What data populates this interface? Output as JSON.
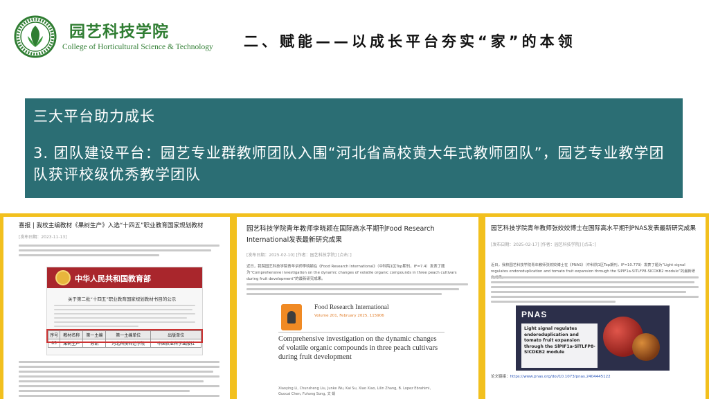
{
  "header": {
    "logo_cn": "园艺科技学院",
    "logo_en": "College of Horticultural Science & Technology",
    "title": "二、赋能——以成长平台夯实“家”的本领"
  },
  "banner": {
    "heading": "三大平台助力成长",
    "body": "3. 团队建设平台：园艺专业群教师团队入围“河北省高校黄大年式教师团队”，园艺专业教学团队获评校级优秀教学团队"
  },
  "colors": {
    "banner_bg": "#2b6e74",
    "frame": "#f2c01e",
    "logo_green": "#2f7d32"
  },
  "docs": {
    "doc1": {
      "title": "喜报 | 我校主编教材《果树生产》入选“十四五”职业教育国家规划教材",
      "meta": "[发布日期：2023-11-13]",
      "moe_name": "中华人民共和国教育部",
      "notice": "关于第二批“十四五”职业教育国家规划教材书目的公示",
      "table": {
        "headers": [
          "序号",
          "教材名称",
          "第一主编",
          "第一主编单位",
          "出版单位"
        ],
        "row": [
          "85",
          "果树生产",
          "苏凯",
          "河北科技师范学院",
          "中国农业科学出版社"
        ]
      }
    },
    "doc2": {
      "title": "园艺科技学院青年教师李晓颖在国际高水平期刊Food Research International发表最新研究成果",
      "meta": "[发布日期：2025-02-10]   [作者：园艺科技学院]   [点击：]",
      "body": "近日，我院园艺科技学院青年讲师李晓颖在《Food Research International》（中科院1区Top期刊，IF=7.4）发表了题为“Comprehensive investigation on the dynamic changes of volatile organic compounds in three peach cultivars during fruit development”的最新研究成果。",
      "journal": "Food Research International",
      "volume": "Volume 201, February 2025, 115906",
      "article": "Comprehensive investigation on the dynamic changes of volatile organic compounds in three peach cultivars during fruit development",
      "authors": "Xiaoying Li, Chunsheng Liu, Junke Wu, Kai Su, Xiao Xiao, Lilin Zhang, B. Lopez Ebrahimi, Guocai Chen, Fuhong Song, 文 娟"
    },
    "doc3": {
      "title": "园艺科技学院青年教师张姣姣博士在国际高水平期刊PNAS发表最新研究成果",
      "meta": "[发布日期：2025-02-17]   [作者：园艺科技学院]   [点击：]",
      "body": "近日，我校园艺科技学院青年教师张姣姣博士在《PNAS》（中科院1区Top期刊，IF=10.779）发表了题为“Light signal regulates endoreduplication and tomato fruit expansion through the SlPIF1a-SlTLFP8-SlCDKB2 module”的最新研究成果。",
      "pnas": "PNAS",
      "article": "Light signal regulates endoreduplication and tomato fruit expansion through the SlPIF1a-SlTLFP8-SlCDKB2 module",
      "ref_label": "论文链接：",
      "ref_url": "https://www.pnas.org/doi/10.1073/pnas.2404445122"
    }
  }
}
